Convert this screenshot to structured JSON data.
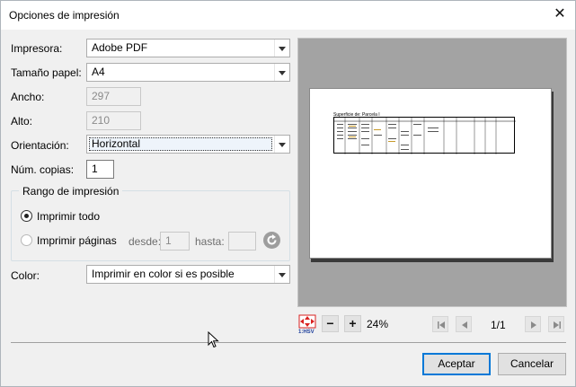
{
  "window": {
    "title": "Opciones de impresión",
    "close_glyph": "✕"
  },
  "form": {
    "printer_label": "Impresora:",
    "printer_value": "Adobe PDF",
    "paper_label": "Tamaño papel:",
    "paper_value": "A4",
    "width_label": "Ancho:",
    "width_value": "297",
    "height_label": "Alto:",
    "height_value": "210",
    "orientation_label": "Orientación:",
    "orientation_value": "Horizontal",
    "copies_label": "Núm. copias:",
    "copies_value": "1",
    "range_group_title": "Rango de impresión",
    "print_all_label": "Imprimir todo",
    "print_pages_label": "Imprimir páginas",
    "from_label": "desde:",
    "from_value": "1",
    "to_label": "hasta:",
    "to_value": "",
    "color_label": "Color:",
    "color_value": "Imprimir en color si es posible"
  },
  "preview": {
    "sheet_title": "Superficie de: Parcela I",
    "scale_label": "1:HSV",
    "zoom_out": "−",
    "zoom_in": "+",
    "zoom_level": "24%",
    "page_indicator": "1/1"
  },
  "buttons": {
    "accept": "Aceptar",
    "cancel": "Cancelar"
  },
  "icons": {
    "close": "close-icon",
    "dropdown": "chevron-down-icon",
    "refresh": "refresh-icon",
    "scale": "scale-icon",
    "first": "first-page-icon",
    "prev": "prev-page-icon",
    "next": "next-page-icon",
    "last": "last-page-icon",
    "cursor": "mouse-cursor-icon"
  },
  "colors": {
    "accent": "#0078d7",
    "preview_bg": "#a3a3a3",
    "scale_red": "#d9201f"
  }
}
